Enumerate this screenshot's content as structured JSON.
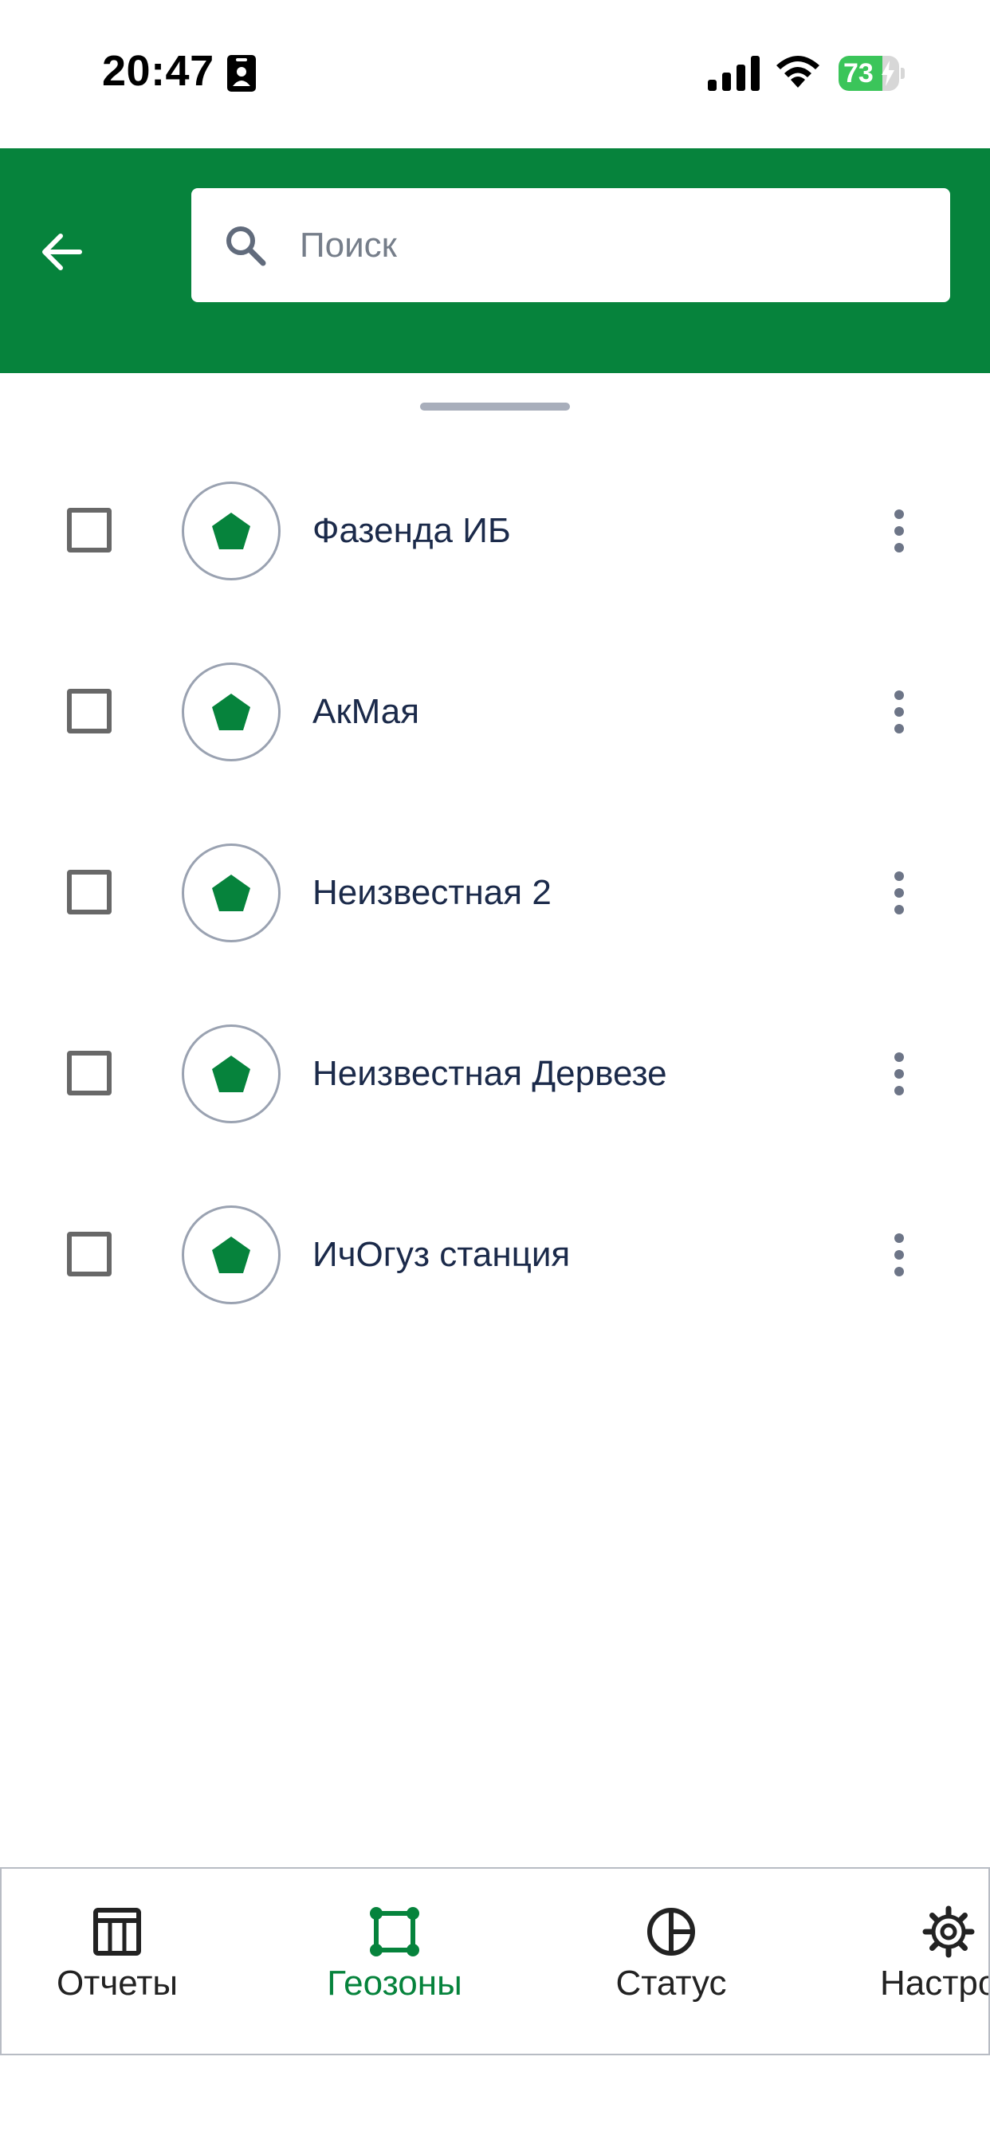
{
  "status_bar": {
    "time": "20:47",
    "battery_level": "73",
    "battery_percent": 73,
    "icons": [
      "id-card-icon",
      "signal-icon",
      "wifi-icon",
      "battery-icon",
      "charging-bolt-icon"
    ]
  },
  "header": {
    "back_icon": "arrow-left-icon",
    "search": {
      "placeholder": "Поиск",
      "value": "",
      "icon": "search-icon"
    },
    "background_color": "#06833c"
  },
  "geozones": {
    "items": [
      {
        "label": "Фазенда ИБ",
        "checked": false,
        "icon": "pentagon-icon"
      },
      {
        "label": "АкМая",
        "checked": false,
        "icon": "pentagon-icon"
      },
      {
        "label": "Неизвестная 2",
        "checked": false,
        "icon": "pentagon-icon"
      },
      {
        "label": "Неизвестная Дервезе",
        "checked": false,
        "icon": "pentagon-icon"
      },
      {
        "label": "ИчОгуз станция",
        "checked": false,
        "icon": "pentagon-icon"
      }
    ],
    "item_menu_icon": "more-vertical-icon"
  },
  "bottom_nav": {
    "tabs": [
      {
        "label": "Отчеты",
        "icon": "table-icon",
        "active": false
      },
      {
        "label": "Геозоны",
        "icon": "polygon-icon",
        "active": true
      },
      {
        "label": "Статус",
        "icon": "pie-chart-icon",
        "active": false
      },
      {
        "label": "Настрой",
        "icon": "gear-icon",
        "active": false
      }
    ]
  },
  "colors": {
    "accent": "#06833c",
    "text": "#1b2a4a",
    "placeholder": "#767e8a",
    "checkbox_border": "#686868",
    "avatar_border": "#9aa2b1",
    "battery": "#3bc55a"
  }
}
